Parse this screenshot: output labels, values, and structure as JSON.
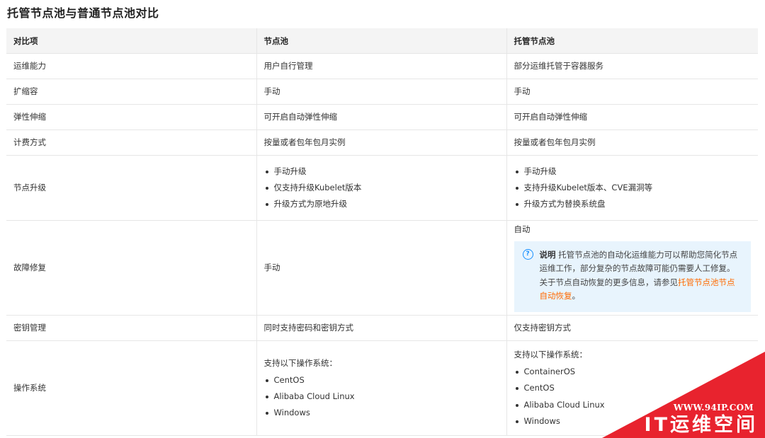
{
  "title": "托管节点池与普通节点池对比",
  "table": {
    "headers": [
      "对比项",
      "节点池",
      "托管节点池"
    ],
    "rows": {
      "ops": {
        "label": "运维能力",
        "pool": "用户自行管理",
        "managed": "部分运维托管于容器服务"
      },
      "scale": {
        "label": "扩缩容",
        "pool": "手动",
        "managed": "手动"
      },
      "elastic": {
        "label": "弹性伸缩",
        "pool": "可开启自动弹性伸缩",
        "managed": "可开启自动弹性伸缩"
      },
      "billing": {
        "label": "计费方式",
        "pool": "按量或者包年包月实例",
        "managed": "按量或者包年包月实例"
      },
      "upgrade": {
        "label": "节点升级",
        "pool": [
          "手动升级",
          "仅支持升级Kubelet版本",
          "升级方式为原地升级"
        ],
        "managed": [
          "手动升级",
          "支持升级Kubelet版本、CVE漏洞等",
          "升级方式为替换系统盘"
        ]
      },
      "fault": {
        "label": "故障修复",
        "pool": "手动",
        "managed": "自动",
        "note": {
          "icon": "question-circle-icon",
          "label": "说明",
          "text": " 托管节点池的自动化运维能力可以帮助您简化节点运维工作，部分复杂的节点故障可能仍需要人工修复。关于节点自动恢复的更多信息，请参见",
          "link": "托管节点池节点自动恢复",
          "end": "。"
        }
      },
      "keys": {
        "label": "密钥管理",
        "pool": "同时支持密码和密钥方式",
        "managed": "仅支持密钥方式"
      },
      "os": {
        "label": "操作系统",
        "pool_lead": "支持以下操作系统：",
        "pool": [
          "CentOS",
          "Alibaba Cloud Linux",
          "Windows"
        ],
        "managed_lead": "支持以下操作系统：",
        "managed": [
          "ContainerOS",
          "CentOS",
          "Alibaba Cloud Linux",
          "Windows"
        ]
      }
    }
  },
  "watermark": {
    "url": "WWW.94IP.COM",
    "name": "IT运维空间",
    "color": "#e8232e"
  }
}
